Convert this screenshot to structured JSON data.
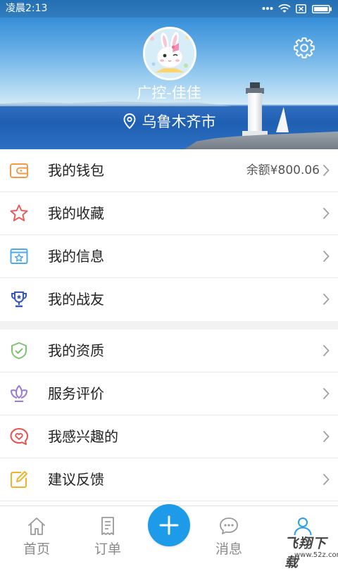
{
  "status_bar": {
    "time": "凌晨2:13",
    "icons": [
      "more-dots-icon",
      "wifi-icon",
      "no-sim-icon",
      "battery-icon"
    ]
  },
  "profile": {
    "name": "广控-佳佳",
    "location": "乌鲁木齐市",
    "avatar_icon": "bunny-avatar",
    "settings_icon": "gear-icon",
    "location_icon": "location-pin-icon"
  },
  "menu_groups": [
    {
      "items": [
        {
          "label": "我的钱包",
          "icon": "wallet-icon",
          "value": "余额¥800.06"
        },
        {
          "label": "我的收藏",
          "icon": "star-icon"
        },
        {
          "label": "我的信息",
          "icon": "info-card-icon"
        },
        {
          "label": "我的战友",
          "icon": "trophy-icon"
        }
      ]
    },
    {
      "items": [
        {
          "label": "我的资质",
          "icon": "shield-check-icon"
        },
        {
          "label": "服务评价",
          "icon": "lotus-icon"
        },
        {
          "label": "我感兴趣的",
          "icon": "heart-bubble-icon"
        },
        {
          "label": "建议反馈",
          "icon": "edit-icon"
        }
      ]
    }
  ],
  "tab_bar": {
    "tabs": [
      {
        "label": "首页",
        "icon": "home-icon",
        "active": false
      },
      {
        "label": "订单",
        "icon": "order-icon",
        "active": false
      },
      {
        "icon": "plus-icon",
        "active": false
      },
      {
        "label": "消息",
        "icon": "message-icon",
        "active": false
      },
      {
        "icon": "profile-icon",
        "active": true
      }
    ]
  },
  "watermark": {
    "brand": "飞翔下载",
    "url": "www.52z.com"
  },
  "colors": {
    "accent": "#1e9be8",
    "text": "#222222",
    "secondary_text": "#555555",
    "divider": "#e8e8e8",
    "section_gap": "#f2f2f2",
    "tab_inactive": "#9a9a9a"
  }
}
